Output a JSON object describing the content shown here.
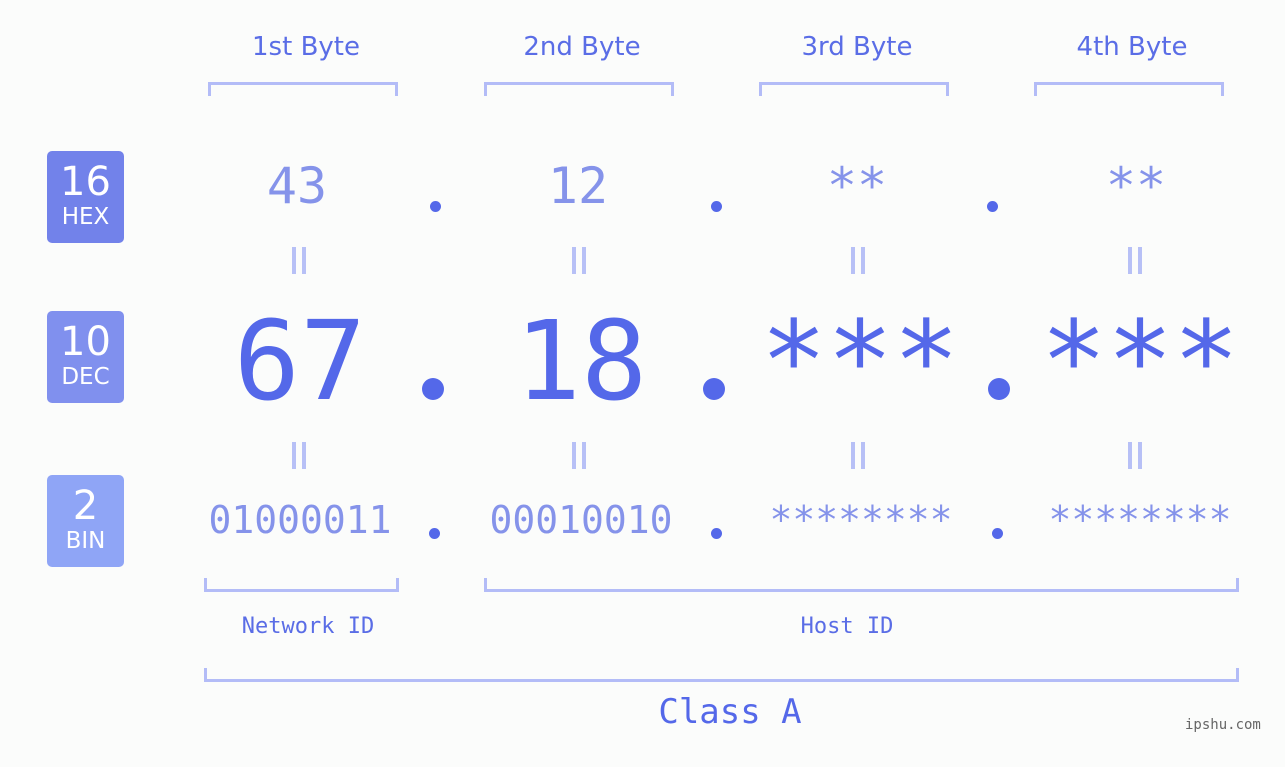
{
  "bytes": [
    {
      "label": "1st Byte",
      "hex": "43",
      "dec": "67",
      "bin": "01000011"
    },
    {
      "label": "2nd Byte",
      "hex": "12",
      "dec": "18",
      "bin": "00010010"
    },
    {
      "label": "3rd Byte",
      "hex": "**",
      "dec": "***",
      "bin": "********"
    },
    {
      "label": "4th Byte",
      "hex": "**",
      "dec": "***",
      "bin": "********"
    }
  ],
  "badges": {
    "hex": {
      "num": "16",
      "label": "HEX",
      "color": "#7282ea"
    },
    "dec": {
      "num": "10",
      "label": "DEC",
      "color": "#8090ee"
    },
    "bin": {
      "num": "2",
      "label": "BIN",
      "color": "#8fa5f6"
    }
  },
  "network_id_label": "Network ID",
  "host_id_label": "Host ID",
  "class_label": "Class A",
  "watermark": "ipshu.com",
  "colors": {
    "accent": "#5468e9",
    "light_text": "#8593ea",
    "bracket": "#b3bcf7"
  }
}
